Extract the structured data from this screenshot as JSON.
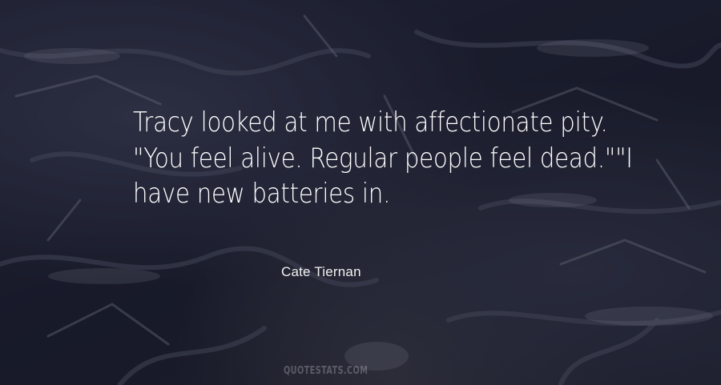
{
  "quote": {
    "text": "Tracy looked at me with affectionate pity. \"You feel alive. Regular people feel dead.\"\"I have new batteries in.",
    "author": "Cate Tiernan"
  },
  "watermark": {
    "text": "QUOTESTATS.COM"
  },
  "colors": {
    "background": "#1f2131",
    "text": "#ffffff"
  }
}
